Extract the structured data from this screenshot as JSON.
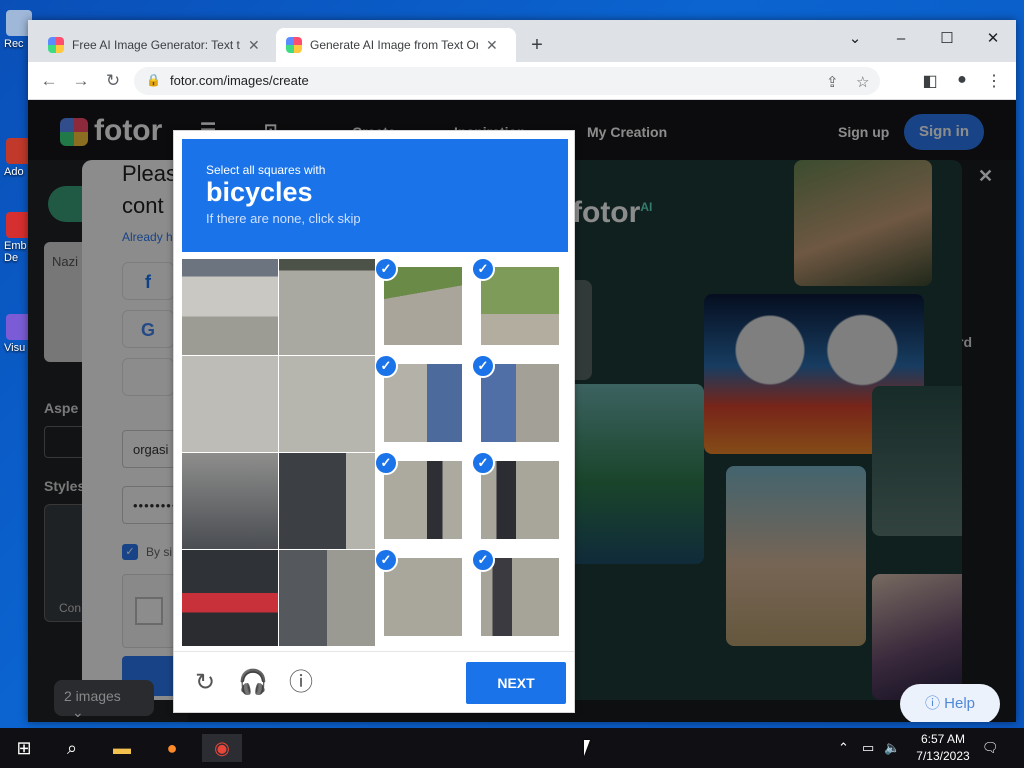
{
  "desktop": {
    "icons": [
      "Rec",
      "Ado",
      "Emb De",
      "Visu"
    ]
  },
  "browser": {
    "tabs": [
      {
        "label": "Free AI Image Generator: Text to"
      },
      {
        "label": "Generate AI Image from Text Onl"
      }
    ],
    "url": "fotor.com/images/create"
  },
  "fotor": {
    "logo": "fotor",
    "nav": [
      "Create",
      "Inspiration",
      "My Creation"
    ],
    "signup": "Sign up",
    "signin": "Sign in",
    "sidebar": {
      "name_placeholder": "Nazi",
      "aspect_label": "Aspe",
      "styles_label": "Styles",
      "style_caption": "Con",
      "images_select": "2 images"
    },
    "right_partial": "rd",
    "help": "Help"
  },
  "login": {
    "title_line1": "Pleas",
    "title_line2": "cont",
    "already": "Already h",
    "email_value": "orgasi",
    "password_value": "••••••••",
    "agree": "By si",
    "brand": "fotor",
    "brand_sup": "AI"
  },
  "captcha": {
    "prompt": "Select all squares with",
    "object": "bicycles",
    "hint": "If there are none, click skip",
    "next": "NEXT",
    "cells": [
      {
        "selected": false
      },
      {
        "selected": false
      },
      {
        "selected": true
      },
      {
        "selected": true
      },
      {
        "selected": false
      },
      {
        "selected": false
      },
      {
        "selected": true
      },
      {
        "selected": true
      },
      {
        "selected": false
      },
      {
        "selected": false
      },
      {
        "selected": true
      },
      {
        "selected": true
      },
      {
        "selected": false
      },
      {
        "selected": false
      },
      {
        "selected": true
      },
      {
        "selected": true
      }
    ]
  },
  "taskbar": {
    "time": "6:57 AM",
    "date": "7/13/2023"
  }
}
